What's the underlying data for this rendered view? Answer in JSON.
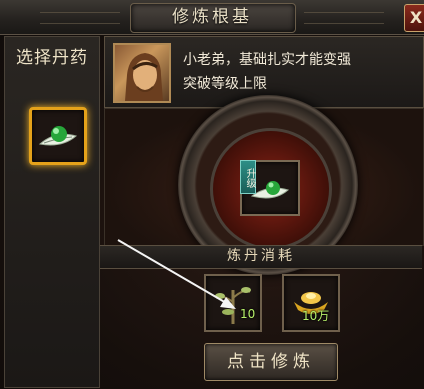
{
  "window": {
    "title": "修炼根基",
    "close_label": "X"
  },
  "left_panel": {
    "title": "选择丹药",
    "selected_item_icon": "green-pill-on-leaf-icon"
  },
  "npc": {
    "portrait_icon": "npc-portrait",
    "message_line1": "小老弟，基础扎实才能变强",
    "message_line2": "突破等级上限"
  },
  "center": {
    "slot_icon": "green-pill-on-leaf-icon",
    "upgrade_tag": "升级"
  },
  "cost": {
    "title": "炼丹消耗",
    "items": [
      {
        "icon": "herb-branch-icon",
        "count": "10"
      },
      {
        "icon": "gold-ingot-icon",
        "count": "10万"
      }
    ]
  },
  "action": {
    "refine_label": "点击修炼"
  },
  "colors": {
    "highlight_gold": "#e5a21a",
    "count_green": "#b7f06a",
    "upgrade_teal": "#2d8e86"
  }
}
